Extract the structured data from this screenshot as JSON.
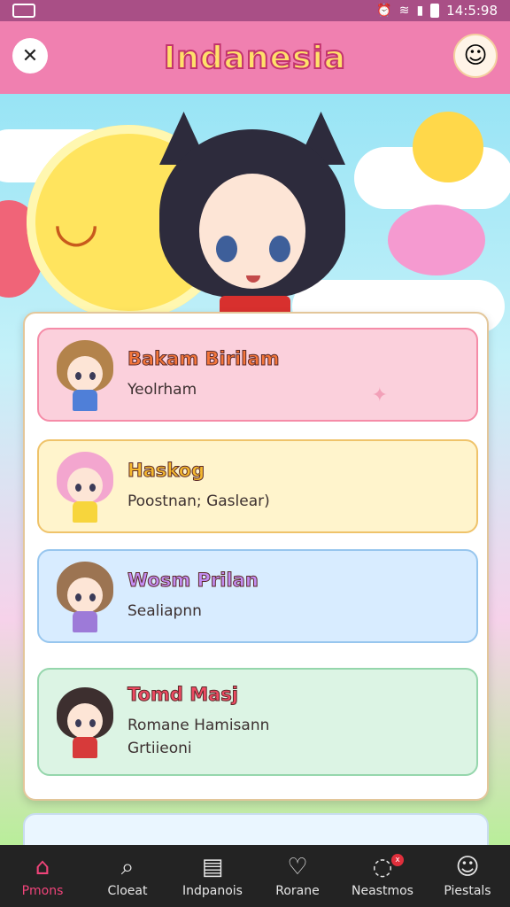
{
  "status_bar": {
    "time": "14:5:98"
  },
  "app_bar": {
    "title": "Indanesia"
  },
  "list": [
    {
      "name": "Bakam Birilam",
      "sub": "Yeolrham",
      "bg": "#fbd0dc",
      "border": "#f58ca8",
      "name_color": "#f4763a",
      "hair": "#b3834b",
      "body": "#4f7fd8"
    },
    {
      "name": "Haskog",
      "sub": "Poostnan; Gaslear)",
      "bg": "#fff4cc",
      "border": "#efc36a",
      "name_color": "#f4b82e",
      "hair": "#f3a6cf",
      "body": "#f7d53c"
    },
    {
      "name": "Wosm Prilan",
      "sub": "Sealiapnn",
      "bg": "#d8ecff",
      "border": "#97c6ee",
      "name_color": "#c28cf2",
      "hair": "#9c7452",
      "body": "#9d7ad8"
    },
    {
      "name": "Tomd Masj",
      "sub": "Romane Hamisann\nGrtiieoni",
      "bg": "#dcf4e4",
      "border": "#95d6ac",
      "name_color": "#ee4a62",
      "hair": "#3d2f2f",
      "body": "#d73a3a"
    }
  ],
  "nav": [
    {
      "label": "Pmons",
      "icon": "home-icon",
      "active": true
    },
    {
      "label": "Cloeat",
      "icon": "search-icon",
      "active": false
    },
    {
      "label": "Indpanois",
      "icon": "grid-icon",
      "active": false
    },
    {
      "label": "Rorane",
      "icon": "heart-icon",
      "active": false
    },
    {
      "label": "Neastmos",
      "icon": "chat-icon",
      "active": false,
      "badge": "x"
    },
    {
      "label": "Piestals",
      "icon": "profile-icon",
      "active": false
    }
  ]
}
